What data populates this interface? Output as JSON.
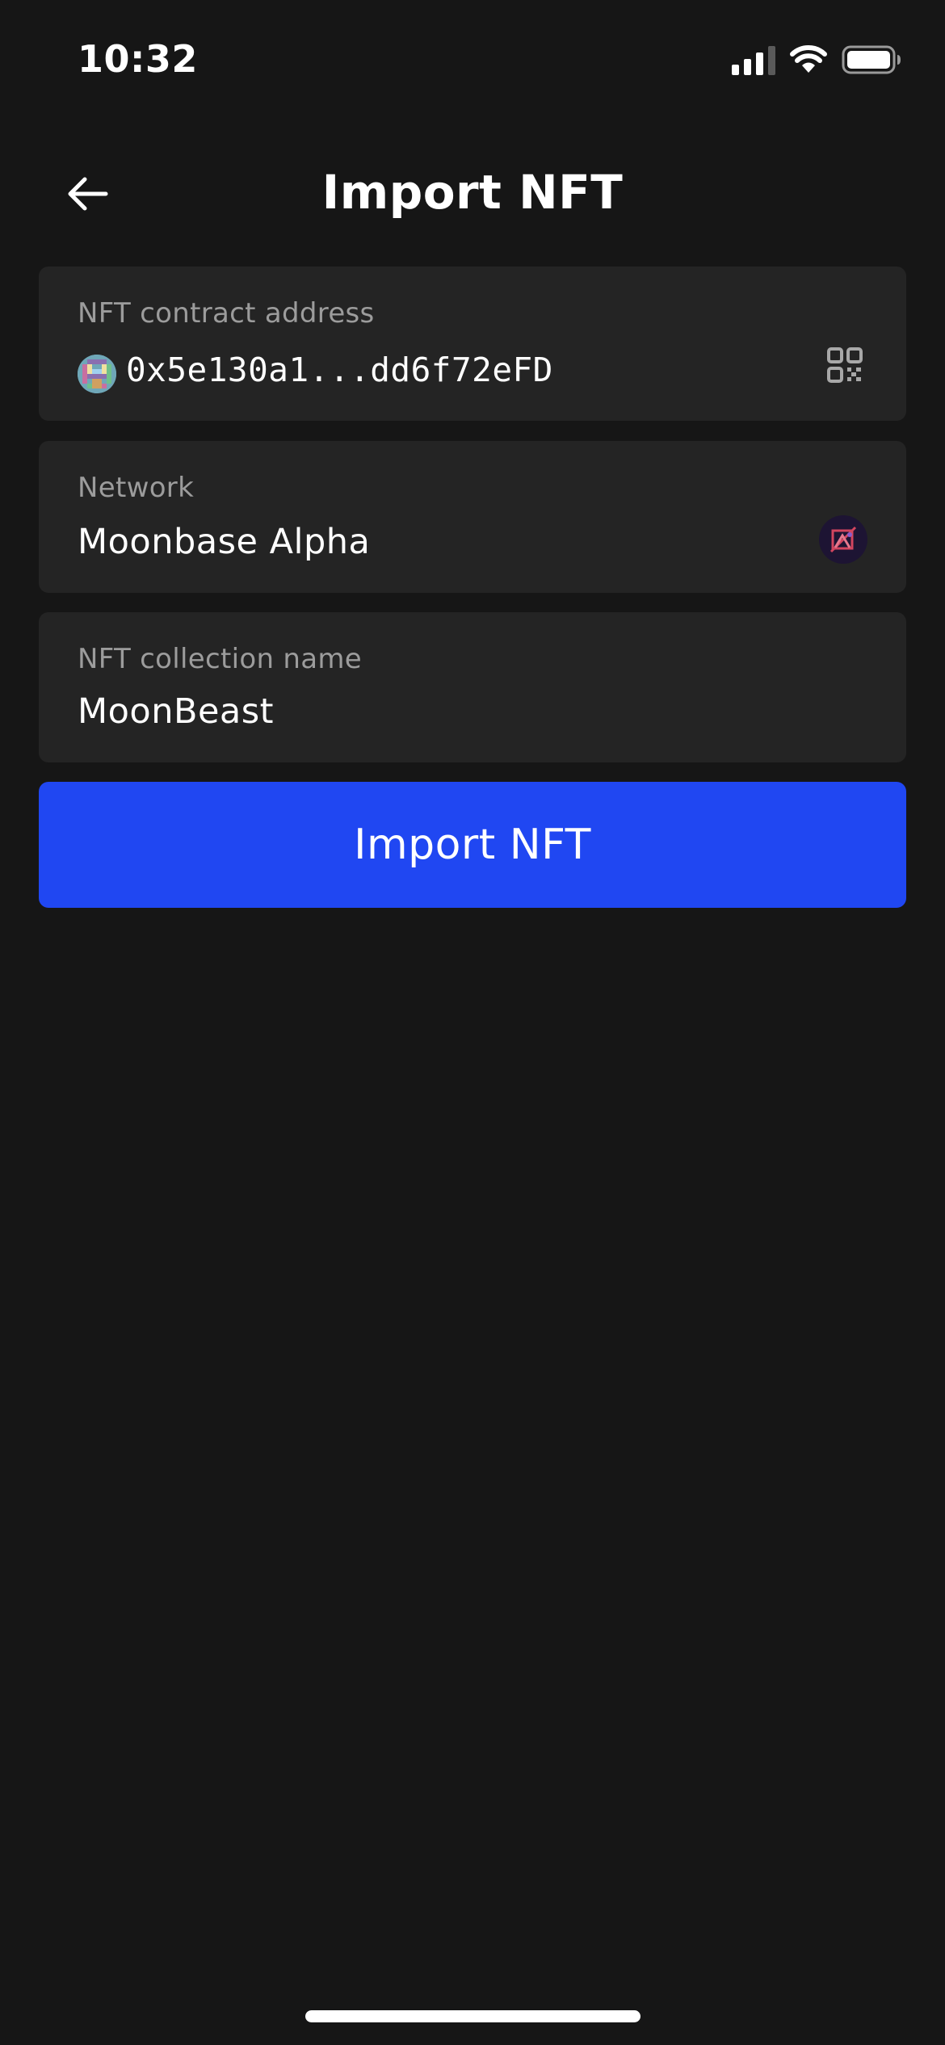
{
  "status_bar": {
    "time": "10:32",
    "icons": [
      "cellular-signal-icon",
      "wifi-icon",
      "battery-icon"
    ]
  },
  "header": {
    "back_icon": "arrow-left-icon",
    "title": "Import NFT"
  },
  "form": {
    "contract_address": {
      "label": "NFT contract address",
      "value": "0x5e130a1...dd6f72eFD",
      "avatar_icon": "token-avatar-icon",
      "action_icon": "qr-code-icon"
    },
    "network": {
      "label": "Network",
      "value": "Moonbase Alpha",
      "logo_icon": "moonbase-alpha-logo-icon"
    },
    "collection_name": {
      "label": "NFT collection name",
      "value": "MoonBeast"
    }
  },
  "actions": {
    "import_label": "Import NFT"
  },
  "colors": {
    "background": "#161616",
    "card": "#242424",
    "label": "#9c9c9c",
    "primary": "#2047f2",
    "text": "#ffffff"
  }
}
